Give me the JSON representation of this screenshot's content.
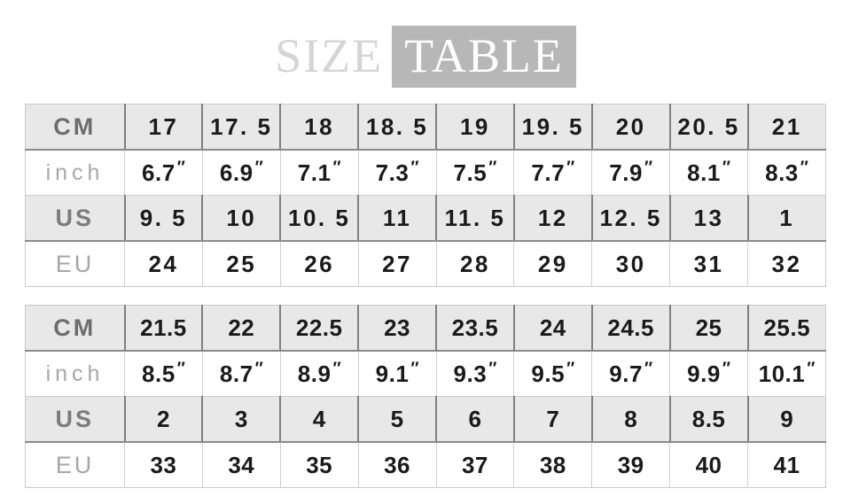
{
  "title": {
    "word_1": "SIZE",
    "word_2": "TABLE",
    "word_1_color": "#d5d5d5",
    "word_2_color": "#ffffff",
    "word_2_background": "#b7b7b7"
  },
  "colors": {
    "page_background": "#ffffff",
    "row_gray": "#e8e8e8",
    "row_white": "#ffffff",
    "value_text": "#1a1a1a",
    "table_border": "#c9c9c9",
    "divider_dark": "#808080",
    "divider_light": "#cfcfcf"
  },
  "row_labels": {
    "cm": "CM",
    "inch": "inch",
    "us": "US",
    "eu": "EU"
  },
  "tables": [
    {
      "id": "table-1",
      "rows": {
        "cm": [
          "17",
          "17. 5",
          "18",
          "18. 5",
          "19",
          "19. 5",
          "20",
          "20. 5",
          "21"
        ],
        "inch": [
          "6.7",
          "6.9",
          "7.1",
          "7.3",
          "7.5",
          "7.7",
          "7.9",
          "8.1",
          "8.3"
        ],
        "inch_mark": "″",
        "us": [
          "9. 5",
          "10",
          "10. 5",
          "11",
          "11. 5",
          "12",
          "12. 5",
          "13",
          "1"
        ],
        "eu": [
          "24",
          "25",
          "26",
          "27",
          "28",
          "29",
          "30",
          "31",
          "32"
        ]
      }
    },
    {
      "id": "table-2",
      "rows": {
        "cm": [
          "21.5",
          "22",
          "22.5",
          "23",
          "23.5",
          "24",
          "24.5",
          "25",
          "25.5"
        ],
        "inch": [
          "8.5",
          "8.7",
          "8.9",
          "9.1",
          "9.3",
          "9.5",
          "9.7",
          "9.9",
          "10.1"
        ],
        "inch_mark": "″",
        "us": [
          "2",
          "3",
          "4",
          "5",
          "6",
          "7",
          "8",
          "8.5",
          "9"
        ],
        "eu": [
          "33",
          "34",
          "35",
          "36",
          "37",
          "38",
          "39",
          "40",
          "41"
        ]
      }
    }
  ]
}
